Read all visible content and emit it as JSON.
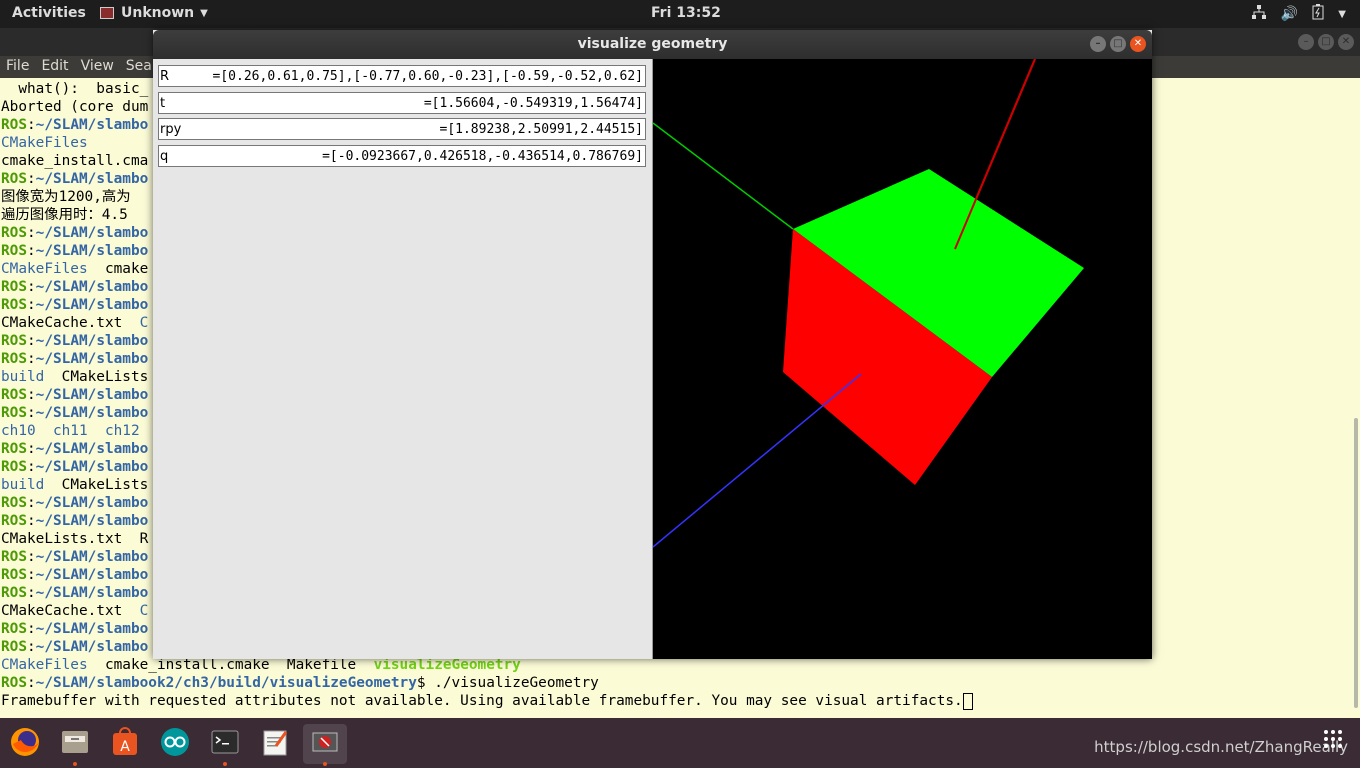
{
  "topbar": {
    "activities": "Activities",
    "app_name": "Unknown",
    "clock": "Fri 13:52"
  },
  "terminal": {
    "menu": [
      "File",
      "Edit",
      "View",
      "Sea"
    ],
    "lines": [
      {
        "parts": [
          {
            "t": "  what():  basic_",
            "c": ""
          }
        ]
      },
      {
        "parts": [
          {
            "t": "Aborted (core dum",
            "c": ""
          }
        ]
      },
      {
        "parts": [
          {
            "t": "ROS",
            "c": "ros"
          },
          {
            "t": ":",
            "c": ""
          },
          {
            "t": "~/SLAM/slambo",
            "c": "path"
          }
        ]
      },
      {
        "parts": [
          {
            "t": "CMakeFiles",
            "c": "dir"
          }
        ]
      },
      {
        "parts": [
          {
            "t": "cmake_install.cma",
            "c": ""
          }
        ]
      },
      {
        "parts": [
          {
            "t": "ROS",
            "c": "ros"
          },
          {
            "t": ":",
            "c": ""
          },
          {
            "t": "~/SLAM/slambo",
            "c": "path"
          }
        ]
      },
      {
        "parts": [
          {
            "t": "图像宽为1200,高为",
            "c": ""
          }
        ]
      },
      {
        "parts": [
          {
            "t": "遍历图像用时：4.5",
            "c": ""
          }
        ]
      },
      {
        "parts": [
          {
            "t": "ROS",
            "c": "ros"
          },
          {
            "t": ":",
            "c": ""
          },
          {
            "t": "~/SLAM/slambo",
            "c": "path"
          }
        ]
      },
      {
        "parts": [
          {
            "t": "ROS",
            "c": "ros"
          },
          {
            "t": ":",
            "c": ""
          },
          {
            "t": "~/SLAM/slambo",
            "c": "path"
          }
        ]
      },
      {
        "parts": [
          {
            "t": "CMakeFiles",
            "c": "dir"
          },
          {
            "t": "  cmake",
            "c": ""
          }
        ]
      },
      {
        "parts": [
          {
            "t": "ROS",
            "c": "ros"
          },
          {
            "t": ":",
            "c": ""
          },
          {
            "t": "~/SLAM/slambo",
            "c": "path"
          }
        ]
      },
      {
        "parts": [
          {
            "t": "ROS",
            "c": "ros"
          },
          {
            "t": ":",
            "c": ""
          },
          {
            "t": "~/SLAM/slambo",
            "c": "path"
          }
        ]
      },
      {
        "parts": [
          {
            "t": "CMakeCache.txt  ",
            "c": ""
          },
          {
            "t": "C",
            "c": "dir"
          }
        ]
      },
      {
        "parts": [
          {
            "t": "ROS",
            "c": "ros"
          },
          {
            "t": ":",
            "c": ""
          },
          {
            "t": "~/SLAM/slambo",
            "c": "path"
          }
        ]
      },
      {
        "parts": [
          {
            "t": "ROS",
            "c": "ros"
          },
          {
            "t": ":",
            "c": ""
          },
          {
            "t": "~/SLAM/slambo",
            "c": "path"
          }
        ]
      },
      {
        "parts": [
          {
            "t": "build",
            "c": "dir"
          },
          {
            "t": "  CMakeLists",
            "c": ""
          }
        ]
      },
      {
        "parts": [
          {
            "t": "ROS",
            "c": "ros"
          },
          {
            "t": ":",
            "c": ""
          },
          {
            "t": "~/SLAM/slambo",
            "c": "path"
          }
        ]
      },
      {
        "parts": [
          {
            "t": "ROS",
            "c": "ros"
          },
          {
            "t": ":",
            "c": ""
          },
          {
            "t": "~/SLAM/slambo",
            "c": "path"
          }
        ]
      },
      {
        "parts": [
          {
            "t": "ch10  ch11  ch12",
            "c": "dir"
          }
        ]
      },
      {
        "parts": [
          {
            "t": "ROS",
            "c": "ros"
          },
          {
            "t": ":",
            "c": ""
          },
          {
            "t": "~/SLAM/slambo",
            "c": "path"
          }
        ]
      },
      {
        "parts": [
          {
            "t": "ROS",
            "c": "ros"
          },
          {
            "t": ":",
            "c": ""
          },
          {
            "t": "~/SLAM/slambo",
            "c": "path"
          }
        ]
      },
      {
        "parts": [
          {
            "t": "build",
            "c": "dir"
          },
          {
            "t": "  CMakeLists",
            "c": ""
          }
        ]
      },
      {
        "parts": [
          {
            "t": "ROS",
            "c": "ros"
          },
          {
            "t": ":",
            "c": ""
          },
          {
            "t": "~/SLAM/slambo",
            "c": "path"
          }
        ]
      },
      {
        "parts": [
          {
            "t": "ROS",
            "c": "ros"
          },
          {
            "t": ":",
            "c": ""
          },
          {
            "t": "~/SLAM/slambo",
            "c": "path"
          }
        ]
      },
      {
        "parts": [
          {
            "t": "CMakeLists.txt  R",
            "c": ""
          }
        ]
      },
      {
        "parts": [
          {
            "t": "ROS",
            "c": "ros"
          },
          {
            "t": ":",
            "c": ""
          },
          {
            "t": "~/SLAM/slambo",
            "c": "path"
          }
        ]
      },
      {
        "parts": [
          {
            "t": "ROS",
            "c": "ros"
          },
          {
            "t": ":",
            "c": ""
          },
          {
            "t": "~/SLAM/slambo",
            "c": "path"
          }
        ]
      },
      {
        "parts": [
          {
            "t": "ROS",
            "c": "ros"
          },
          {
            "t": ":",
            "c": ""
          },
          {
            "t": "~/SLAM/slambo",
            "c": "path"
          }
        ]
      },
      {
        "parts": [
          {
            "t": "CMakeCache.txt  ",
            "c": ""
          },
          {
            "t": "C",
            "c": "dir"
          }
        ]
      },
      {
        "parts": [
          {
            "t": "ROS",
            "c": "ros"
          },
          {
            "t": ":",
            "c": ""
          },
          {
            "t": "~/SLAM/slambo",
            "c": "path"
          }
        ]
      },
      {
        "parts": [
          {
            "t": "ROS",
            "c": "ros"
          },
          {
            "t": ":",
            "c": ""
          },
          {
            "t": "~/SLAM/slambo",
            "c": "path"
          }
        ]
      },
      {
        "parts": [
          {
            "t": "CMakeFiles",
            "c": "dir"
          },
          {
            "t": "  cmake_install.cmake  Makefile  ",
            "c": ""
          },
          {
            "t": "visualizeGeometry",
            "c": "exe"
          }
        ]
      },
      {
        "parts": [
          {
            "t": "ROS",
            "c": "ros"
          },
          {
            "t": ":",
            "c": ""
          },
          {
            "t": "~/SLAM/slambook2/ch3/build/visualizeGeometry",
            "c": "path"
          },
          {
            "t": "$ ./visualizeGeometry",
            "c": ""
          }
        ]
      },
      {
        "parts": [
          {
            "t": "Framebuffer with requested attributes not available. Using available framebuffer. You may see visual artifacts.",
            "c": ""
          }
        ],
        "cursor": true
      }
    ]
  },
  "window": {
    "title": "visualize geometry",
    "fields": [
      {
        "label": "R",
        "value": "=[0.26,0.61,0.75],[-0.77,0.60,-0.23],[-0.59,-0.52,0.62]"
      },
      {
        "label": "t",
        "value": "=[1.56604,-0.549319,1.56474]"
      },
      {
        "label": "rpy",
        "value": "=[1.89238,2.50991,2.44515]"
      },
      {
        "label": "q",
        "value": "=[-0.0923667,0.426518,-0.436514,0.786769]"
      }
    ]
  },
  "dock": {
    "items": [
      "firefox-icon",
      "files-icon",
      "software-center-icon",
      "arduino-icon",
      "terminal-icon",
      "text-editor-icon",
      "visualize-geometry-icon"
    ],
    "watermark": "https://blog.csdn.net/ZhangReally"
  },
  "colors": {
    "cube_top": "#00ff00",
    "cube_front": "#ff0000",
    "cube_side": "#0000ff",
    "accent": "#e95420"
  }
}
